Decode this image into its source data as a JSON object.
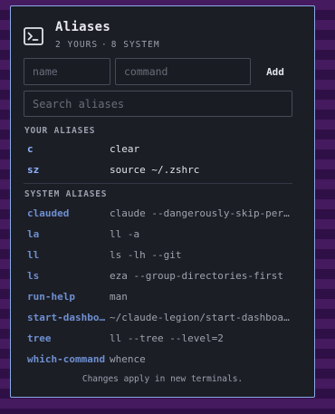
{
  "header": {
    "title": "Aliases",
    "user_count": "2 YOURS",
    "separator": "·",
    "system_count": "8 SYSTEM",
    "icon": "terminal-icon"
  },
  "form": {
    "name_placeholder": "name",
    "name_value": "",
    "command_placeholder": "command",
    "command_value": "",
    "add_label": "Add"
  },
  "search": {
    "placeholder": "Search aliases",
    "value": ""
  },
  "user_section": {
    "label": "YOUR ALIASES",
    "items": [
      {
        "name": "c",
        "command": "clear"
      },
      {
        "name": "sz",
        "command": "source ~/.zshrc"
      }
    ]
  },
  "system_section": {
    "label": "SYSTEM ALIASES",
    "items": [
      {
        "name": "clauded",
        "command": "claude --dangerously-skip-permissions"
      },
      {
        "name": "la",
        "command": "ll -a"
      },
      {
        "name": "ll",
        "command": "ls -lh --git"
      },
      {
        "name": "ls",
        "command": "eza --group-directories-first"
      },
      {
        "name": "run-help",
        "command": "man"
      },
      {
        "name": "start-dashboard",
        "command": "~/claude-legion/start-dashboard.sh"
      },
      {
        "name": "tree",
        "command": "ll --tree --level=2"
      },
      {
        "name": "which-command",
        "command": "whence"
      }
    ]
  },
  "footer": {
    "note": "Changes apply in new terminals."
  },
  "colors": {
    "border": "#8aa9e8",
    "panel": "#1c1e26",
    "user_alias": "#8eb4ff",
    "system_alias": "#6e8fd0"
  }
}
